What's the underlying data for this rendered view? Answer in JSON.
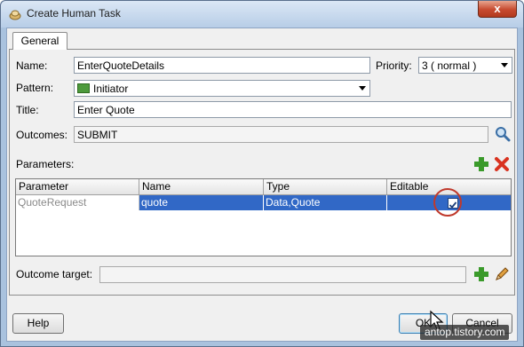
{
  "window": {
    "title": "Create Human Task",
    "close_glyph": "x"
  },
  "tabs": [
    {
      "label": "General",
      "selected": true
    }
  ],
  "form": {
    "name_label": "Name:",
    "name_value": "EnterQuoteDetails",
    "priority_label": "Priority:",
    "priority_value": "3 ( normal )",
    "pattern_label": "Pattern:",
    "pattern_value": "Initiator",
    "title_label": "Title:",
    "title_value": "Enter Quote",
    "outcomes_label": "Outcomes:",
    "outcomes_value": "SUBMIT",
    "parameters_label": "Parameters:",
    "outcome_target_label": "Outcome target:",
    "outcome_target_value": ""
  },
  "parameters_table": {
    "columns": [
      "Parameter",
      "Name",
      "Type",
      "Editable"
    ],
    "rows": [
      {
        "parameter": "QuoteRequest",
        "name": "quote",
        "type": "Data,Quote",
        "editable": true
      }
    ]
  },
  "buttons": {
    "help": "Help",
    "ok": "OK",
    "cancel": "Cancel"
  },
  "watermark": "antop.tistory.com",
  "colors": {
    "selection": "#3168c6",
    "add_icon": "#3a9a2a",
    "remove_icon": "#d9321f",
    "highlight_circle": "#c0392b"
  }
}
